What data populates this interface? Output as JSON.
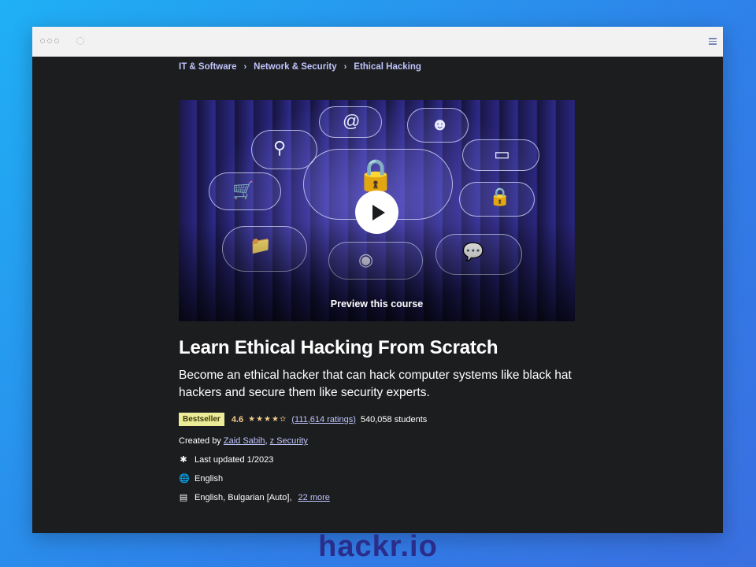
{
  "breadcrumb": [
    "IT & Software",
    "Network & Security",
    "Ethical Hacking"
  ],
  "hero": {
    "preview_label": "Preview this course"
  },
  "course": {
    "title": "Learn Ethical Hacking From Scratch",
    "subtitle": "Become an ethical hacker that can hack computer systems like black hat hackers and secure them like security experts.",
    "badge": "Bestseller",
    "rating": "4.6",
    "stars": "★★★★✫",
    "ratings_count": "(111,614 ratings)",
    "students": "540,058 students",
    "created_by_label": "Created by",
    "authors": [
      "Zaid Sabih",
      "z Security"
    ],
    "last_updated": "Last updated 1/2023",
    "language": "English",
    "captions": "English, Bulgarian [Auto],",
    "captions_more": "22 more"
  },
  "icons": {
    "hero": [
      "at-icon",
      "user-icon",
      "search-icon",
      "tablet-icon",
      "lock-icon",
      "cart-icon",
      "folder-icon",
      "camera-icon",
      "chat-icon"
    ]
  },
  "brand": "hackr.io",
  "colors": {
    "accent": "#c0c4fc",
    "star": "#f3ca8c",
    "badge": "#eceb98",
    "background": "#1c1d1f"
  }
}
